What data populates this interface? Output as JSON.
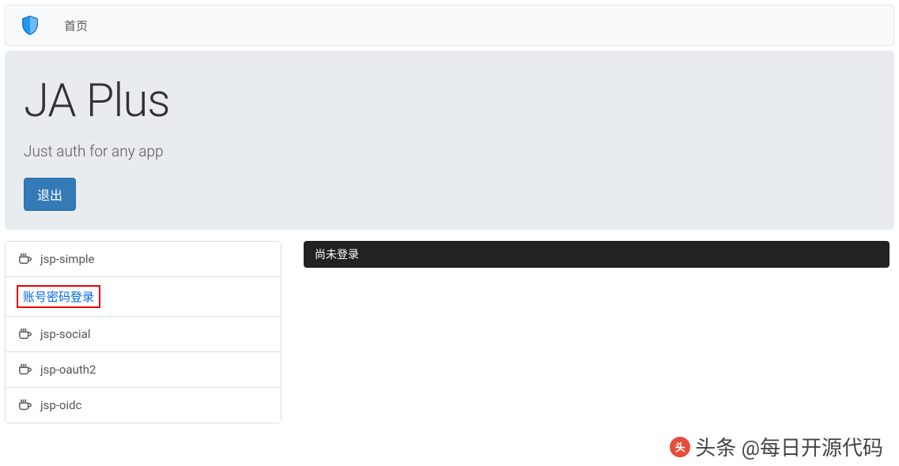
{
  "navbar": {
    "home_label": "首页"
  },
  "jumbotron": {
    "title": "JA Plus",
    "subtitle": "Just auth for any app",
    "logout_label": "退出"
  },
  "sidebar": {
    "items": [
      {
        "label": "jsp-simple",
        "icon": "coffee"
      },
      {
        "label": "账号密码登录",
        "highlighted": true
      },
      {
        "label": "jsp-social",
        "icon": "coffee"
      },
      {
        "label": "jsp-oauth2",
        "icon": "coffee"
      },
      {
        "label": "jsp-oidc",
        "icon": "coffee"
      }
    ]
  },
  "main": {
    "status_text": "尚未登录"
  },
  "watermark": {
    "text": "头条 @每日开源代码"
  }
}
